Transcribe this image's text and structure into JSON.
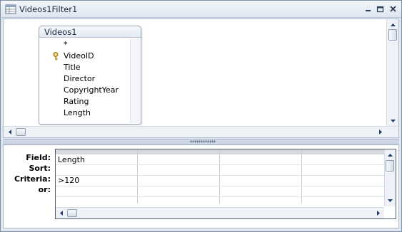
{
  "window": {
    "title": "Videos1Filter1",
    "controls": {
      "minimize": "minimize-icon",
      "maximize": "maximize-icon",
      "close": "close-icon"
    }
  },
  "table": {
    "name": "Videos1",
    "fields": [
      {
        "label": "*",
        "primary_key": false
      },
      {
        "label": "VideoID",
        "primary_key": true
      },
      {
        "label": "Title",
        "primary_key": false
      },
      {
        "label": "Director",
        "primary_key": false
      },
      {
        "label": "CopyrightYear",
        "primary_key": false
      },
      {
        "label": "Rating",
        "primary_key": false
      },
      {
        "label": "Length",
        "primary_key": false
      }
    ]
  },
  "grid": {
    "row_labels": {
      "field": "Field:",
      "sort": "Sort:",
      "criteria": "Criteria:",
      "or": "or:"
    },
    "columns": [
      {
        "field": "Length",
        "sort": "",
        "criteria": ">120",
        "or": ""
      },
      {
        "field": "",
        "sort": "",
        "criteria": "",
        "or": ""
      },
      {
        "field": "",
        "sort": "",
        "criteria": "",
        "or": ""
      },
      {
        "field": "",
        "sort": "",
        "criteria": "",
        "or": ""
      }
    ]
  },
  "colors": {
    "key_icon": "#c9a227",
    "arrow": "#1f3d67",
    "frame": "#7b8da8"
  }
}
